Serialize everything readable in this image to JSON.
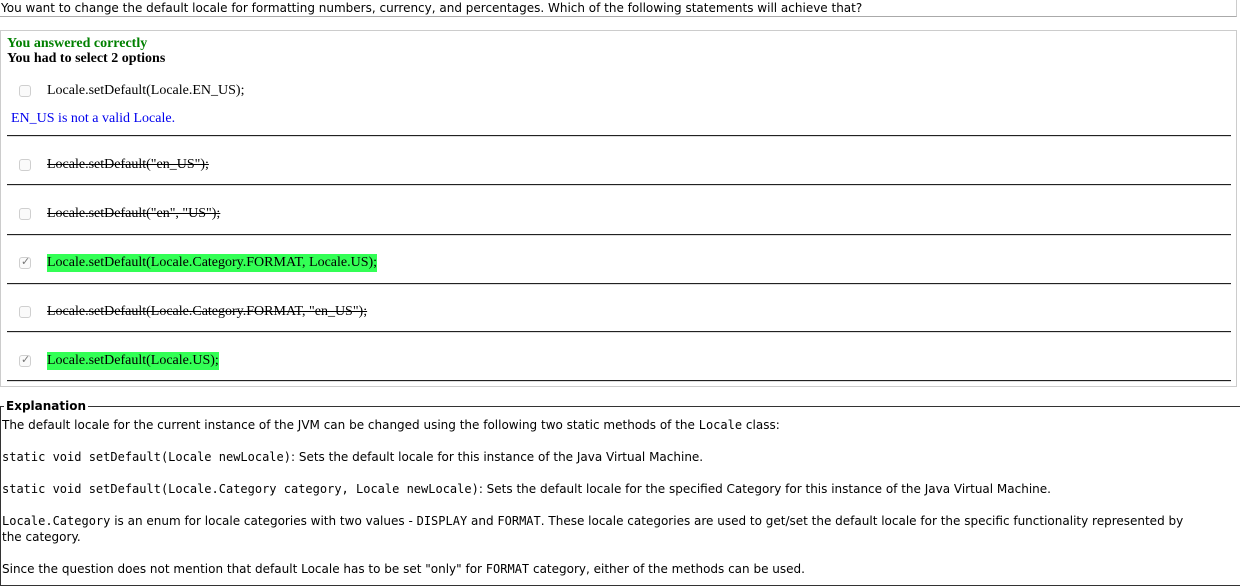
{
  "question": "You want to change the default locale for formatting numbers, currency, and percentages. Which of the following statements will achieve that?",
  "result": {
    "status": "You answered correctly",
    "instruction": "You had to select 2 options"
  },
  "options": [
    {
      "text": "Locale.setDefault(Locale.EN_US);",
      "checked": false
    },
    {
      "text": "Locale.setDefault(\"en_US\");",
      "checked": false
    },
    {
      "text": "Locale.setDefault(\"en\", \"US\");",
      "checked": false
    },
    {
      "text": "Locale.setDefault(Locale.Category.FORMAT, Locale.US);",
      "checked": true
    },
    {
      "text": "Locale.setDefault(Locale.Category.FORMAT, \"en_US\");",
      "checked": false
    },
    {
      "text": "Locale.setDefault(Locale.US);",
      "checked": true
    }
  ],
  "feedback": "EN_US is not a valid Locale.",
  "colors": {
    "correct_text": "#008000",
    "feedback_text": "#0000ee",
    "correct_highlight": "#33ff55"
  },
  "explanation": {
    "title": "Explanation",
    "p1_before": "The default locale for the current instance of the JVM can be changed using the following two static methods of the ",
    "p1_code": "Locale",
    "p1_after": " class:",
    "p2_code": "static void setDefault(Locale newLocale)",
    "p2_text": ": Sets the default locale for this instance of the Java Virtual Machine.",
    "p3_code": "static void setDefault(Locale.Category category, Locale newLocale)",
    "p3_text": ": Sets the default locale for the specified Category for this instance of the Java Virtual Machine.",
    "p4_code1": "Locale.Category",
    "p4_text1": " is an enum for locale categories with two values - ",
    "p4_code2": "DISPLAY",
    "p4_text2": " and ",
    "p4_code3": "FORMAT",
    "p4_text3": ". These locale categories are used to get/set the default locale for the specific functionality represented by the category.",
    "p5_text1": "Since the question does not mention that default Locale has to be set \"only\" for ",
    "p5_code": "FORMAT",
    "p5_text2": " category, either of the methods can be used."
  }
}
